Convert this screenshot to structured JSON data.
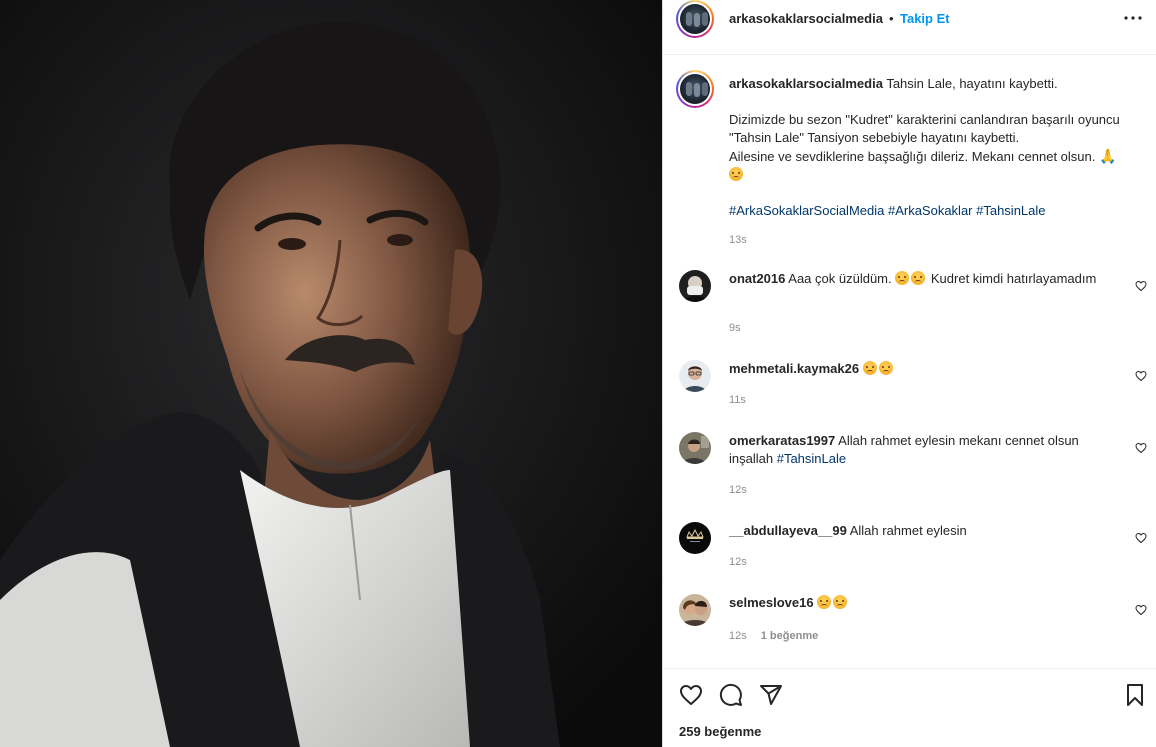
{
  "post": {
    "username": "arkasokaklarsocialmedia",
    "separator": "•",
    "follow_label": "Takip Et",
    "likes_label": "259 beğenme"
  },
  "caption": {
    "username": "arkasokaklarsocialmedia",
    "line1": "Tahsin Lale, hayatını kaybetti.",
    "para_a": "Dizimizde bu sezon \"Kudret\" karakterini canlandıran başarılı oyuncu \"Tahsin Lale\" Tansiyon sebebiyle hayatını kaybetti.",
    "para_b": "Ailesine ve sevdiklerine başsağlığı dileriz. Mekanı cennet olsun.",
    "hashtags": "#ArkaSokaklarSocialMedia #ArkaSokaklar #TahsinLale",
    "time": "13s"
  },
  "comments": [
    {
      "username": "onat2016",
      "text_before": "Aaa çok üzüldüm.",
      "emojis": 2,
      "text_after": "Kudret kimdi hatırlayamadım",
      "time": "9s",
      "likes": ""
    },
    {
      "username": "mehmetali.kaymak26",
      "text_before": "",
      "emojis": 2,
      "text_after": "",
      "time": "11s",
      "likes": ""
    },
    {
      "username": "omerkaratas1997",
      "text_before": "Allah rahmet eylesin mekanı cennet olsun inşallah",
      "hashtag": "#TahsinLale",
      "emojis": 0,
      "text_after": "",
      "time": "12s",
      "likes": ""
    },
    {
      "username": "__abdullayeva__99",
      "text_before": "Allah rahmet eylesin",
      "emojis": 0,
      "text_after": "",
      "time": "12s",
      "likes": ""
    },
    {
      "username": "selmeslove16",
      "text_before": "",
      "emojis": 2,
      "text_after": "",
      "time": "12s",
      "likes": "1 beğenme"
    }
  ],
  "icons": {
    "more": "more-horizontal-icon",
    "heart": "heart-icon",
    "comment": "comment-icon",
    "share": "paper-plane-icon",
    "save": "bookmark-icon"
  },
  "colors": {
    "accent": "#0095f6",
    "hashtag": "#00376b",
    "muted": "#8e8e8e",
    "text": "#262626"
  }
}
